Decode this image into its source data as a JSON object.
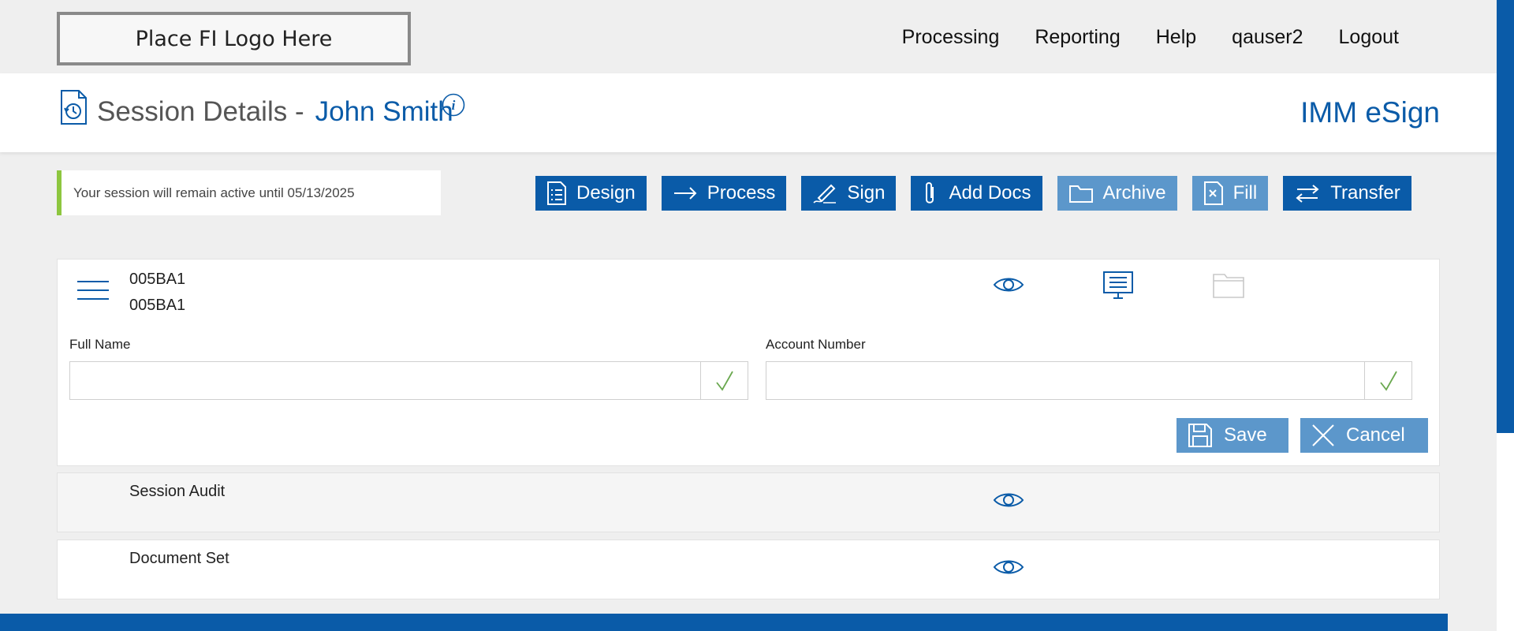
{
  "header": {
    "logo_text": "Place FI Logo Here",
    "nav": [
      "Processing",
      "Reporting",
      "Help",
      "qauser2",
      "Logout"
    ]
  },
  "title": {
    "prefix": "Session Details -",
    "name": "John Smith",
    "app_name": "IMM eSign"
  },
  "notice": {
    "text": "Your session will remain active until 05/13/2025"
  },
  "actions": {
    "design": "Design",
    "process": "Process",
    "sign": "Sign",
    "add_docs": "Add Docs",
    "archive": "Archive",
    "fill": "Fill",
    "transfer": "Transfer"
  },
  "document": {
    "id_line1": "005BA1",
    "id_line2": "005BA1",
    "fields": {
      "full_name_label": "Full Name",
      "full_name_value": "",
      "account_number_label": "Account Number",
      "account_number_value": ""
    },
    "save_label": "Save",
    "cancel_label": "Cancel"
  },
  "rows": {
    "session_audit": "Session Audit",
    "document_set": "Document Set"
  },
  "colors": {
    "brand_blue": "#0a5ba8",
    "light_blue": "#5c97cb",
    "notice_green": "#8dc63f",
    "check_green": "#6aa84f"
  }
}
